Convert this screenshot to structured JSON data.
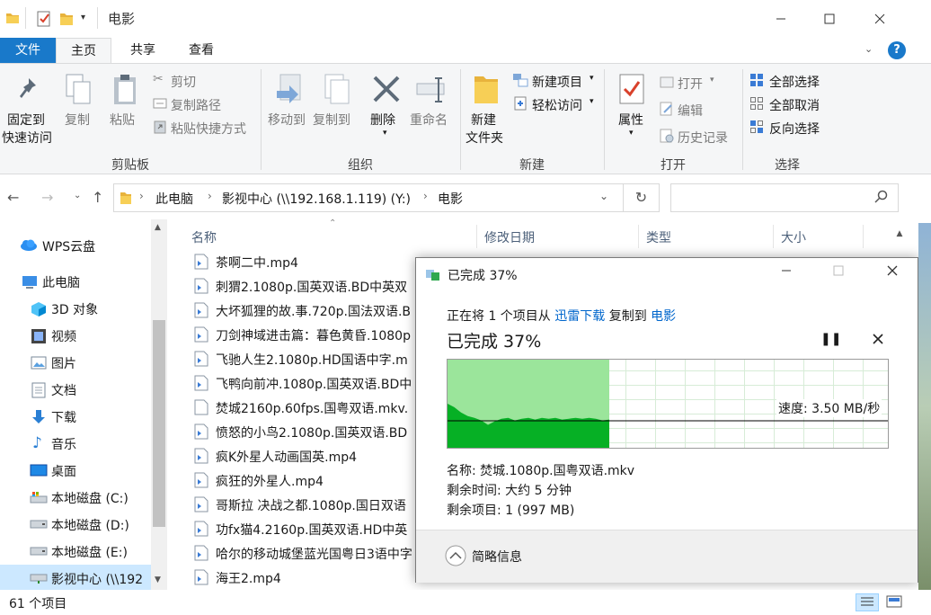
{
  "window": {
    "title": "电影"
  },
  "tabs": {
    "file": "文件",
    "home": "主页",
    "share": "共享",
    "view": "查看"
  },
  "ribbon": {
    "clipboard": {
      "group": "剪贴板",
      "pin_line1": "固定到",
      "pin_line2": "快速访问",
      "copy": "复制",
      "paste": "粘贴",
      "cut": "剪切",
      "copy_path": "复制路径",
      "paste_shortcut": "粘贴快捷方式"
    },
    "organize": {
      "group": "组织",
      "move_to": "移动到",
      "copy_to": "复制到",
      "delete": "删除",
      "rename": "重命名"
    },
    "new": {
      "group": "新建",
      "new_folder_line1": "新建",
      "new_folder_line2": "文件夹",
      "new_item": "新建项目",
      "easy_access": "轻松访问"
    },
    "open": {
      "group": "打开",
      "properties": "属性",
      "open": "打开",
      "edit": "编辑",
      "history": "历史记录"
    },
    "select": {
      "group": "选择",
      "select_all": "全部选择",
      "select_none": "全部取消",
      "invert": "反向选择"
    }
  },
  "address": {
    "crumbs": [
      "此电脑",
      "影视中心 (\\\\192.168.1.119) (Y:)",
      "电影"
    ]
  },
  "nav": {
    "items": [
      "WPS云盘",
      "此电脑",
      "3D 对象",
      "视频",
      "图片",
      "文档",
      "下载",
      "音乐",
      "桌面",
      "本地磁盘 (C:)",
      "本地磁盘 (D:)",
      "本地磁盘 (E:)",
      "影视中心 (\\\\192"
    ]
  },
  "columns": {
    "name": "名称",
    "modified": "修改日期",
    "type": "类型",
    "size": "大小"
  },
  "files": [
    "茶啊二中.mp4",
    "刺猬2.1080p.国英双语.BD中英双",
    "大坏狐狸的故.事.720p.国法双语.B",
    "刀剑神域进击篇：暮色黄昏.1080p",
    "飞驰人生2.1080p.HD国语中字.m",
    "飞鸭向前冲.1080p.国英双语.BD中",
    "焚城2160p.60fps.国粤双语.mkv.",
    "愤怒的小鸟2.1080p.国英双语.BD",
    "疯K外星人动画国英.mp4",
    "疯狂的外星人.mp4",
    "哥斯拉 决战之都.1080p.国日双语",
    "功fx猫4.2160p.国英双语.HD中英",
    "哈尔的移动城堡蓝光国粤日3语中字",
    "海王2.mp4"
  ],
  "dialog": {
    "title": "已完成 37%",
    "copy_prefix": "正在将 1 个项目从",
    "source": "迅雷下载",
    "copy_middle": "复制到",
    "dest": "电影",
    "progress_text": "已完成 37%",
    "progress": 0.37,
    "speed_label": "速度: 3.50 MB/秒",
    "name_label": "名称:",
    "name_value": "焚城.1080p.国粤双语.mkv",
    "time_label": "剩余时间:",
    "time_value": "大约 5 分钟",
    "items_label": "剩余项目:",
    "items_value": "1 (997 MB)",
    "less_details": "简略信息",
    "colors": {
      "fill": "#06b025",
      "area": "#9be59b",
      "link": "#0066cc"
    }
  },
  "status": {
    "count": "61 个项目"
  }
}
